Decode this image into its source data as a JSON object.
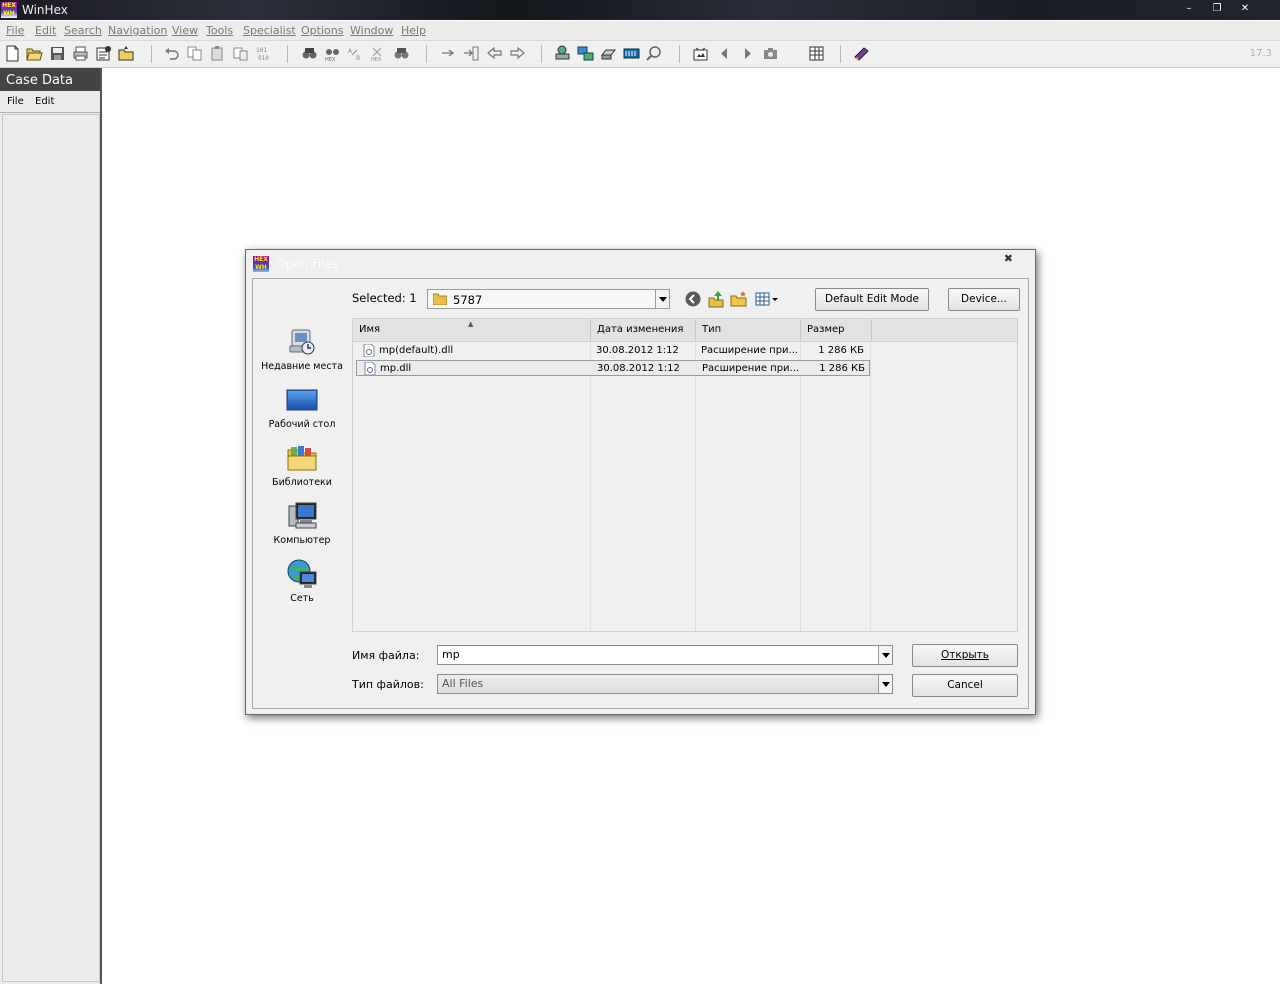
{
  "window": {
    "title": "WinHex"
  },
  "menu": [
    "File",
    "Edit",
    "Search",
    "Navigation",
    "View",
    "Tools",
    "Specialist",
    "Options",
    "Window",
    "Help"
  ],
  "toolbar": {
    "version": "17.3"
  },
  "case_panel": {
    "title": "Case Data",
    "menu": [
      "File",
      "Edit"
    ]
  },
  "dialog": {
    "title": "Open Files",
    "selected_label": "Selected: 1",
    "look_in": "5787",
    "buttons": {
      "default_edit_mode": "Default Edit Mode",
      "device": "Device...",
      "open": "Открыть",
      "cancel": "Cancel"
    },
    "places": [
      {
        "label": "Недавние места",
        "icon": "recent-places-icon"
      },
      {
        "label": "Рабочий стол",
        "icon": "desktop-icon"
      },
      {
        "label": "Библиотеки",
        "icon": "libraries-icon"
      },
      {
        "label": "Компьютер",
        "icon": "computer-icon"
      },
      {
        "label": "Сеть",
        "icon": "network-icon"
      }
    ],
    "columns": [
      "Имя",
      "Дата изменения",
      "Тип",
      "Размер"
    ],
    "files": [
      {
        "name": "mp(default).dll",
        "modified": "30.08.2012 1:12",
        "type": "Расширение при...",
        "size": "1 286 КБ"
      },
      {
        "name": "mp.dll",
        "modified": "30.08.2012 1:12",
        "type": "Расширение при...",
        "size": "1 286 КБ"
      }
    ],
    "filename_label": "Имя файла:",
    "filename_value": "mp",
    "filetype_label": "Тип файлов:",
    "filetype_value": "All Files"
  },
  "colors": {
    "titlebar": "#1c1e26",
    "case_header": "#444444",
    "menu_text": "#7a7a7a"
  }
}
